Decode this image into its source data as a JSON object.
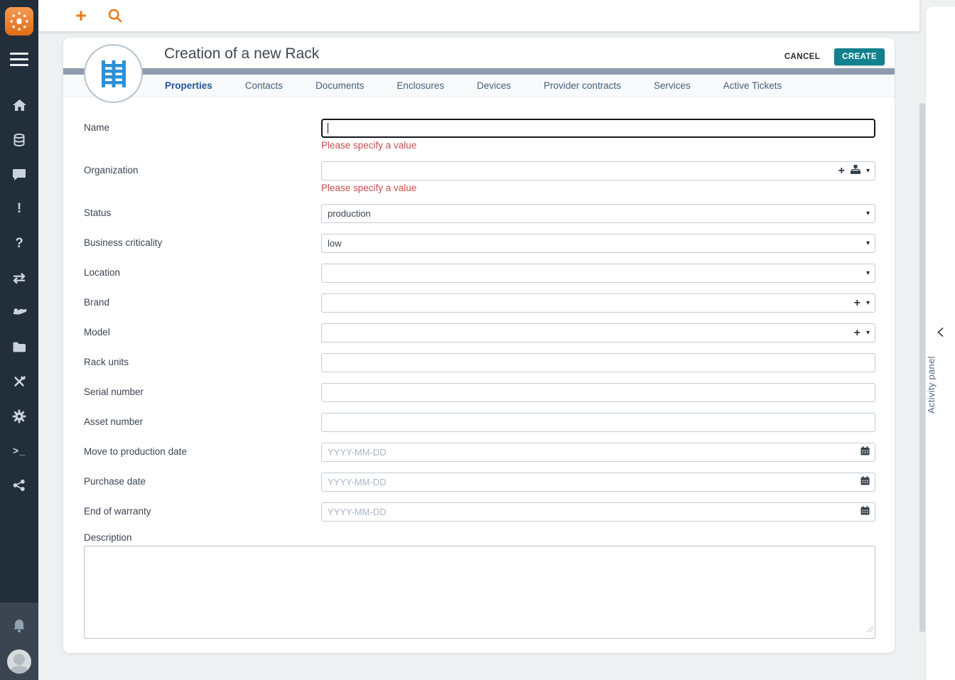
{
  "topbar": {
    "plus_glyph": "+",
    "icons": [
      "plus-icon",
      "search-icon"
    ]
  },
  "sidebar": {
    "logo": "itop-logo",
    "glyphs": {
      "exclamation": "!",
      "question": "?",
      "transfer": "⇄",
      "terminal": ">_"
    },
    "icon_names": [
      "hamburger-icon",
      "home-icon",
      "database-icon",
      "chat-icon",
      "exclamation-icon",
      "question-icon",
      "transfer-arrows-icon",
      "hand-icon",
      "folder-icon",
      "tools-icon",
      "gear-icon",
      "terminal-icon",
      "share-icon",
      "bell-icon",
      "user-avatar"
    ]
  },
  "header": {
    "title": "Creation of a new Rack",
    "cancel_label": "CANCEL",
    "create_label": "CREATE",
    "object_icon": "rack-icon"
  },
  "tabs": [
    {
      "label": "Properties",
      "active": true
    },
    {
      "label": "Contacts",
      "active": false
    },
    {
      "label": "Documents",
      "active": false
    },
    {
      "label": "Enclosures",
      "active": false
    },
    {
      "label": "Devices",
      "active": false
    },
    {
      "label": "Provider contracts",
      "active": false
    },
    {
      "label": "Services",
      "active": false
    },
    {
      "label": "Active Tickets",
      "active": false
    }
  ],
  "form": {
    "fields": [
      {
        "label": "Name",
        "type": "text",
        "value": "",
        "state": "focused",
        "error": "Please specify a value"
      },
      {
        "label": "Organization",
        "type": "picker-hierarchy",
        "value": "",
        "error": "Please specify a value",
        "icons": [
          "plus-icon",
          "hierarchy-icon",
          "caret-down-icon"
        ]
      },
      {
        "label": "Status",
        "type": "select",
        "value": "production"
      },
      {
        "label": "Business criticality",
        "type": "select",
        "value": "low"
      },
      {
        "label": "Location",
        "type": "select",
        "value": ""
      },
      {
        "label": "Brand",
        "type": "picker",
        "value": "",
        "icons": [
          "plus-icon",
          "caret-down-icon"
        ]
      },
      {
        "label": "Model",
        "type": "picker",
        "value": "",
        "icons": [
          "plus-icon",
          "caret-down-icon"
        ]
      },
      {
        "label": "Rack units",
        "type": "text",
        "value": ""
      },
      {
        "label": "Serial number",
        "type": "text",
        "value": ""
      },
      {
        "label": "Asset number",
        "type": "text",
        "value": ""
      },
      {
        "label": "Move to production date",
        "type": "date",
        "value": "",
        "placeholder": "YYYY-MM-DD",
        "icons": [
          "calendar-icon"
        ]
      },
      {
        "label": "Purchase date",
        "type": "date",
        "value": "",
        "placeholder": "YYYY-MM-DD",
        "icons": [
          "calendar-icon"
        ]
      },
      {
        "label": "End of warranty",
        "type": "date",
        "value": "",
        "placeholder": "YYYY-MM-DD",
        "icons": [
          "calendar-icon"
        ]
      },
      {
        "label": "Description",
        "type": "textarea",
        "value": ""
      }
    ],
    "picker_glyphs": {
      "plus": "+",
      "caret": "▾"
    }
  },
  "activity_panel": {
    "label": "Activity panel",
    "collapse_icon": "chevron-left-icon"
  },
  "colors": {
    "accent_orange": "#e87b1e",
    "create_teal": "#11818d",
    "error_red": "#c84d4d",
    "active_tab_blue": "#24549c",
    "rack_blue": "#2d8fd6",
    "sidebar_dark": "#232e3b",
    "sidebar_footer": "#3a4551",
    "header_band": "#8e9cad"
  }
}
